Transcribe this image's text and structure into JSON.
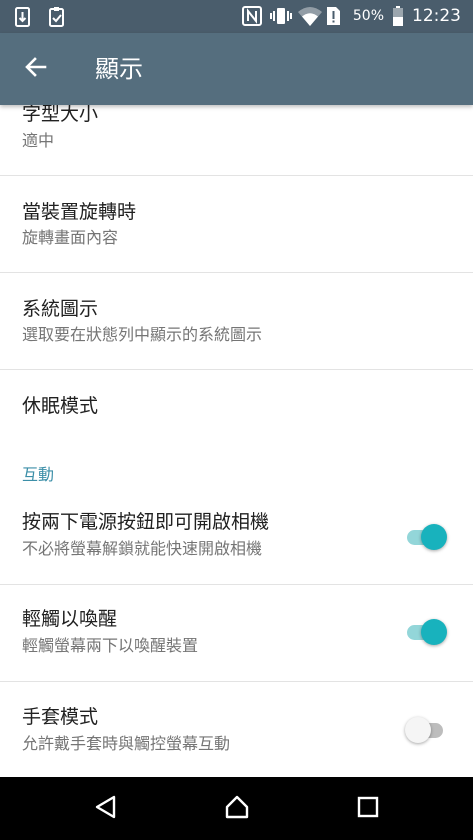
{
  "status_bar": {
    "battery_percent": "50%",
    "time": "12:23"
  },
  "app_bar": {
    "title": "顯示"
  },
  "items": [
    {
      "title": "字型大小",
      "subtitle": "適中"
    },
    {
      "title": "當裝置旋轉時",
      "subtitle": "旋轉畫面內容"
    },
    {
      "title": "系統圖示",
      "subtitle": "選取要在狀態列中顯示的系統圖示"
    },
    {
      "title": "休眠模式"
    }
  ],
  "section": {
    "header": "互動",
    "items": [
      {
        "title": "按兩下電源按鈕即可開啟相機",
        "subtitle": "不必將螢幕解鎖就能快速開啟相機",
        "enabled": true
      },
      {
        "title": "輕觸以喚醒",
        "subtitle": "輕觸螢幕兩下以喚醒裝置",
        "enabled": true
      },
      {
        "title": "手套模式",
        "subtitle": "允許戴手套時與觸控螢幕互動",
        "enabled": false
      }
    ]
  },
  "colors": {
    "status_bar": "#4a5d6c",
    "app_bar": "#556e7e",
    "accent": "#18b2bd",
    "section_header": "#3c8fa8"
  },
  "icons": {
    "status_left": [
      "sd-card-icon",
      "clipboard-check-icon"
    ],
    "status_right": [
      "nfc-icon",
      "vibrate-icon",
      "wifi-icon",
      "sim-alert-icon",
      "battery-icon"
    ],
    "navigation": [
      "back-triangle-icon",
      "home-circle-icon",
      "recents-square-icon"
    ]
  }
}
